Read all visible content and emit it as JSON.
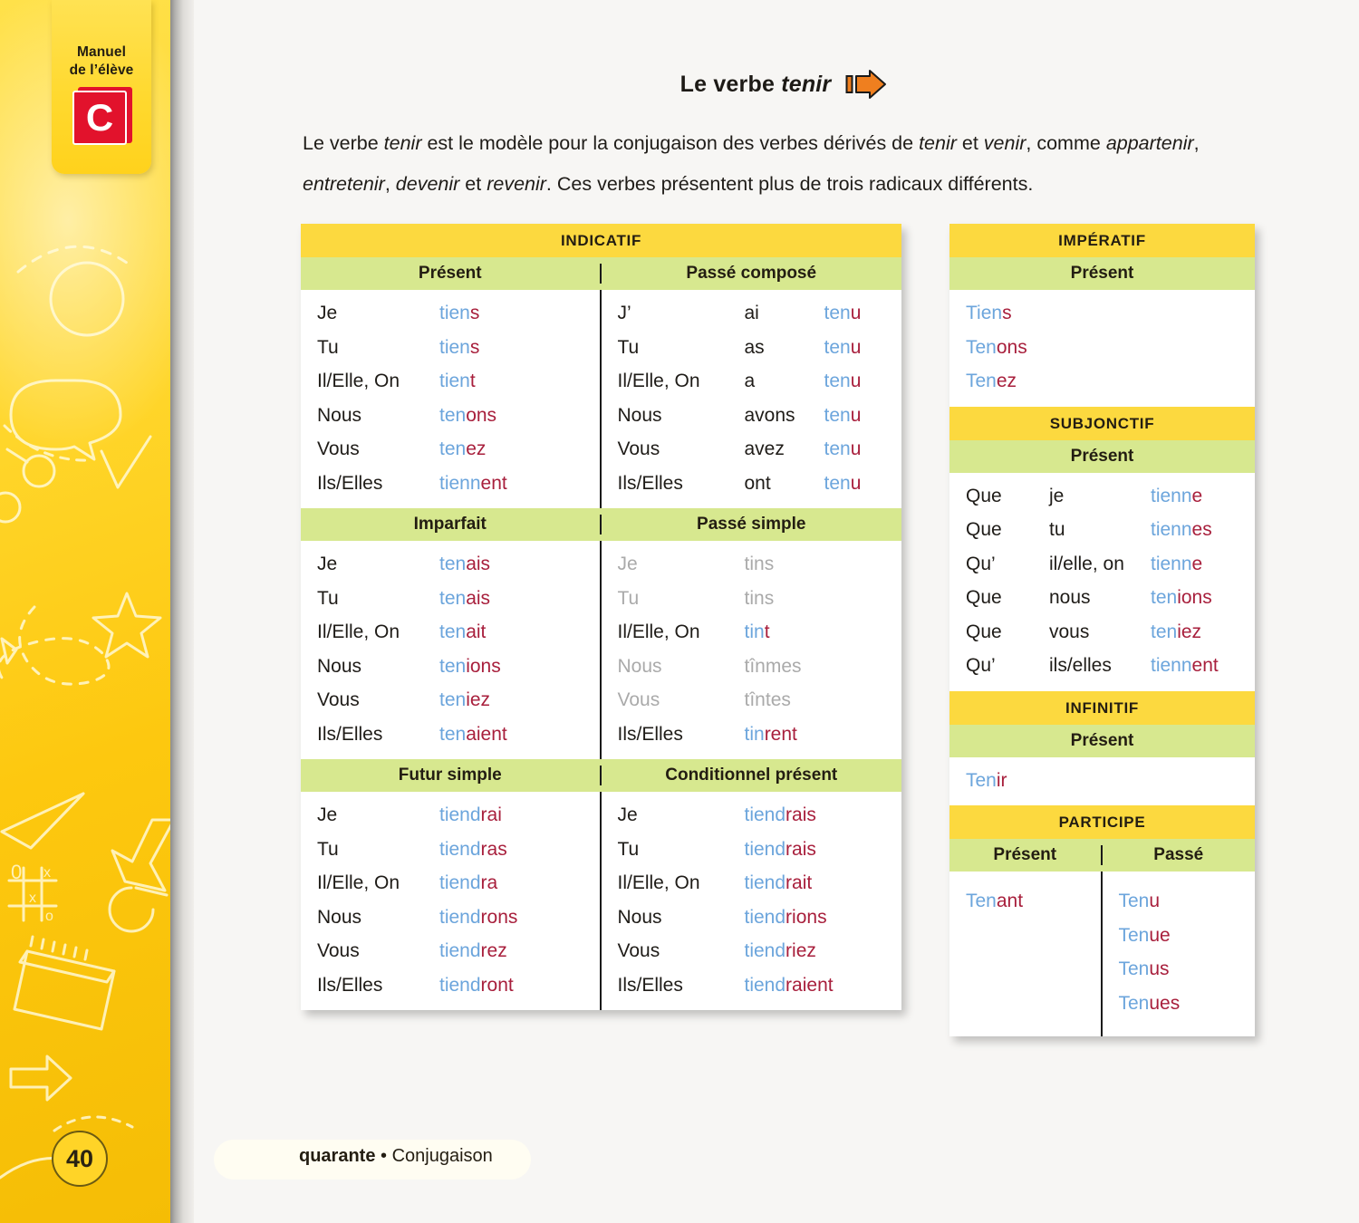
{
  "sidebar": {
    "tab_label_line1": "Manuel",
    "tab_label_line2": "de l’élève",
    "tab_letter": "C",
    "page_number": "40"
  },
  "heading": {
    "prefix": "Le verbe ",
    "verb": "tenir",
    "arrow_icon": "arrow-right-icon",
    "arrow_color": "#ef7f1f"
  },
  "intro": {
    "line1_a": "Le verbe ",
    "line1_verb1": "tenir",
    "line1_b": " est le modèle pour la conjugaison des verbes dérivés de ",
    "line1_verb2": "tenir",
    "line1_c": " et ",
    "line1_verb3": "venir",
    "line1_d": ", comme",
    "line2_verb1": "appartenir",
    "line2_a": ", ",
    "line2_verb2": "entretenir",
    "line2_b": ", ",
    "line2_verb3": "devenir",
    "line2_c": " et ",
    "line2_verb4": "revenir",
    "line2_d": ". Ces verbes présentent plus de trois radicaux différents."
  },
  "colors": {
    "band_yellow": "#fcd93f",
    "band_green": "#d7e88f",
    "stem_blue": "#6ca5dc",
    "ending_red": "#a81f3c",
    "muted_grey": "#aaaaaa",
    "sidebar_yellow": "#ffd62b",
    "book_red": "#e2122c"
  },
  "indicatif": {
    "title": "INDICATIF",
    "present": {
      "label": "Présent",
      "rows": [
        {
          "pron": "Je",
          "stem": "tien",
          "end": "s",
          "muted": false
        },
        {
          "pron": "Tu",
          "stem": "tien",
          "end": "s",
          "muted": false
        },
        {
          "pron": "Il/Elle, On",
          "stem": "tien",
          "end": "t",
          "muted": false
        },
        {
          "pron": "Nous",
          "stem": "ten",
          "end": "ons",
          "muted": false
        },
        {
          "pron": "Vous",
          "stem": "ten",
          "end": "ez",
          "muted": false
        },
        {
          "pron": "Ils/Elles",
          "stem": "tienn",
          "end": "ent",
          "muted": false
        }
      ]
    },
    "passe_compose": {
      "label": "Passé composé",
      "rows": [
        {
          "pron": "J’",
          "aux": "ai",
          "stem": "ten",
          "end": "u",
          "muted": false
        },
        {
          "pron": "Tu",
          "aux": "as",
          "stem": "ten",
          "end": "u",
          "muted": false
        },
        {
          "pron": "Il/Elle, On",
          "aux": "a",
          "stem": "ten",
          "end": "u",
          "muted": false
        },
        {
          "pron": "Nous",
          "aux": "avons",
          "stem": "ten",
          "end": "u",
          "muted": false
        },
        {
          "pron": "Vous",
          "aux": "avez",
          "stem": "ten",
          "end": "u",
          "muted": false
        },
        {
          "pron": "Ils/Elles",
          "aux": "ont",
          "stem": "ten",
          "end": "u",
          "muted": false
        }
      ]
    },
    "imparfait": {
      "label": "Imparfait",
      "rows": [
        {
          "pron": "Je",
          "stem": "ten",
          "end": "ais",
          "muted": false
        },
        {
          "pron": "Tu",
          "stem": "ten",
          "end": "ais",
          "muted": false
        },
        {
          "pron": "Il/Elle, On",
          "stem": "ten",
          "end": "ait",
          "muted": false
        },
        {
          "pron": "Nous",
          "stem": "ten",
          "end": "ions",
          "muted": false
        },
        {
          "pron": "Vous",
          "stem": "ten",
          "end": "iez",
          "muted": false
        },
        {
          "pron": "Ils/Elles",
          "stem": "ten",
          "end": "aient",
          "muted": false
        }
      ]
    },
    "passe_simple": {
      "label": "Passé simple",
      "rows": [
        {
          "pron": "Je",
          "stem": "t",
          "end": "ins",
          "muted": true
        },
        {
          "pron": "Tu",
          "stem": "t",
          "end": "ins",
          "muted": true
        },
        {
          "pron": "Il/Elle, On",
          "stem": "tin",
          "end": "t",
          "muted": false
        },
        {
          "pron": "Nous",
          "stem": "t",
          "end": "înmes",
          "muted": true
        },
        {
          "pron": "Vous",
          "stem": "t",
          "end": "întes",
          "muted": true
        },
        {
          "pron": "Ils/Elles",
          "stem": "tin",
          "end": "rent",
          "muted": false
        }
      ]
    },
    "futur_simple": {
      "label": "Futur simple",
      "rows": [
        {
          "pron": "Je",
          "stem": "tiend",
          "end": "rai",
          "muted": false
        },
        {
          "pron": "Tu",
          "stem": "tiend",
          "end": "ras",
          "muted": false
        },
        {
          "pron": "Il/Elle, On",
          "stem": "tiend",
          "end": "ra",
          "muted": false
        },
        {
          "pron": "Nous",
          "stem": "tiend",
          "end": "rons",
          "muted": false
        },
        {
          "pron": "Vous",
          "stem": "tiend",
          "end": "rez",
          "muted": false
        },
        {
          "pron": "Ils/Elles",
          "stem": "tiend",
          "end": "ront",
          "muted": false
        }
      ]
    },
    "conditionnel_present": {
      "label": "Conditionnel présent",
      "rows": [
        {
          "pron": "Je",
          "stem": "tiend",
          "end": "rais",
          "muted": false
        },
        {
          "pron": "Tu",
          "stem": "tiend",
          "end": "rais",
          "muted": false
        },
        {
          "pron": "Il/Elle, On",
          "stem": "tiend",
          "end": "rait",
          "muted": false
        },
        {
          "pron": "Nous",
          "stem": "tiend",
          "end": "rions",
          "muted": false
        },
        {
          "pron": "Vous",
          "stem": "tiend",
          "end": "riez",
          "muted": false
        },
        {
          "pron": "Ils/Elles",
          "stem": "tiend",
          "end": "raient",
          "muted": false
        }
      ]
    }
  },
  "imperatif": {
    "title": "IMPÉRATIF",
    "present_label": "Présent",
    "rows": [
      {
        "stem": "Tien",
        "end": "s",
        "muted": false
      },
      {
        "stem": "Ten",
        "end": "ons",
        "muted": false
      },
      {
        "stem": "Ten",
        "end": "ez",
        "muted": false
      }
    ]
  },
  "subjonctif": {
    "title": "SUBJONCTIF",
    "present_label": "Présent",
    "rows": [
      {
        "que": "Que",
        "pron": "je",
        "stem": "tienn",
        "end": "e",
        "muted": false
      },
      {
        "que": "Que",
        "pron": "tu",
        "stem": "tienn",
        "end": "es",
        "muted": false
      },
      {
        "que": "Qu’",
        "pron": "il/elle, on",
        "stem": "tienn",
        "end": "e",
        "muted": false
      },
      {
        "que": "Que",
        "pron": "nous",
        "stem": "ten",
        "end": "ions",
        "muted": false
      },
      {
        "que": "Que",
        "pron": "vous",
        "stem": "ten",
        "end": "iez",
        "muted": false
      },
      {
        "que": "Qu’",
        "pron": "ils/elles",
        "stem": "tienn",
        "end": "ent",
        "muted": false
      }
    ]
  },
  "infinitif": {
    "title": "INFINITIF",
    "present_label": "Présent",
    "rows": [
      {
        "stem": "Ten",
        "end": "ir",
        "muted": false
      }
    ]
  },
  "participe": {
    "title": "PARTICIPE",
    "present_label": "Présent",
    "passe_label": "Passé",
    "present_rows": [
      {
        "stem": "Ten",
        "end": "ant",
        "muted": false
      }
    ],
    "passe_rows": [
      {
        "stem": "Ten",
        "end": "u",
        "muted": false
      },
      {
        "stem": "Ten",
        "end": "ue",
        "muted": false
      },
      {
        "stem": "Ten",
        "end": "us",
        "muted": false
      },
      {
        "stem": "Ten",
        "end": "ues",
        "muted": false
      }
    ]
  },
  "footer": {
    "page_word": "quarante",
    "separator": " • ",
    "section": "Conjugaison"
  }
}
